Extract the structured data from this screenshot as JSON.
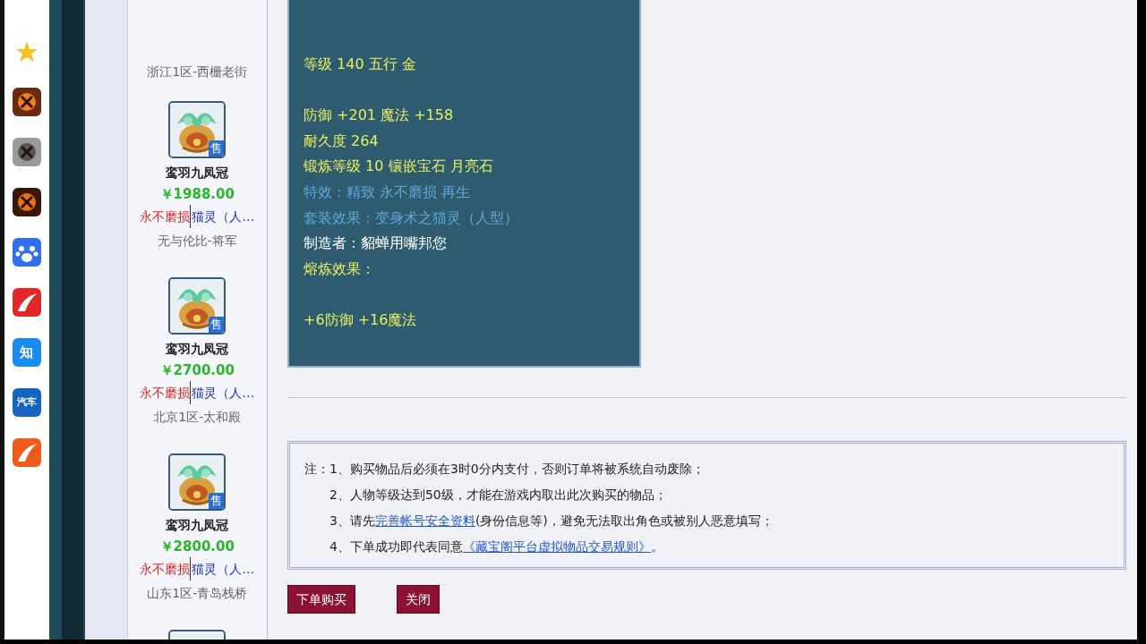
{
  "sidebar_apps": [
    {
      "kind": "star"
    },
    {
      "kind": "dragon"
    },
    {
      "kind": "long"
    },
    {
      "kind": "blast"
    },
    {
      "kind": "paw"
    },
    {
      "kind": "swoosh"
    },
    {
      "kind": "zhi",
      "label": "知"
    },
    {
      "kind": "car",
      "label": "汽车"
    },
    {
      "kind": "wing"
    }
  ],
  "items": [
    {
      "kind": "top_fragment",
      "location": "浙江1区-西栅老街"
    },
    {
      "badge": "售",
      "name": "鸾羽九凤冠",
      "price": "￥1988.00",
      "tags": [
        {
          "kind": "effect",
          "text": "永不磨损"
        },
        {
          "kind": "suit",
          "text": "猫灵（人…"
        }
      ],
      "location": "无与伦比-将军"
    },
    {
      "badge": "售",
      "name": "鸾羽九凤冠",
      "price": "￥2700.00",
      "tags": [
        {
          "kind": "effect",
          "text": "永不磨损"
        },
        {
          "kind": "suit",
          "text": "猫灵（人…"
        }
      ],
      "location": "北京1区-太和殿"
    },
    {
      "badge": "售",
      "name": "鸾羽九凤冠",
      "price": "￥2800.00",
      "tags": [
        {
          "kind": "effect",
          "text": "永不磨损"
        },
        {
          "kind": "suit",
          "text": "猫灵（人…"
        }
      ],
      "location": "山东1区-青岛栈桥"
    },
    {
      "kind": "bottom_fragment"
    }
  ],
  "tooltip_lines": [
    {
      "kind": "stat",
      "text": "等级 140 五行 金"
    },
    {
      "kind": "blank"
    },
    {
      "kind": "stat",
      "text": "防御 +201 魔法 +158"
    },
    {
      "kind": "stat",
      "text": "耐久度 264"
    },
    {
      "kind": "stat",
      "text": "锻炼等级 10 镶嵌宝石 月亮石"
    },
    {
      "kind": "special",
      "text": "特效：精致 永不磨损 再生"
    },
    {
      "kind": "special",
      "text": "套装效果：变身术之猫灵（人型）"
    },
    {
      "kind": "maker",
      "text": "制造者：貂蝉用嘴邦您"
    },
    {
      "kind": "stat",
      "text": "熔炼效果："
    },
    {
      "kind": "blank"
    },
    {
      "kind": "stat",
      "text": "+6防御 +16魔法"
    }
  ],
  "notes": {
    "label": "注：",
    "items": [
      {
        "number": "1、",
        "parts": [
          {
            "text": "购买物品后必须在3时0分内支付，否则订单将被系统自动废除；"
          }
        ]
      },
      {
        "number": "2、",
        "parts": [
          {
            "text": "人物等级达到50级，才能在游戏内取出此次购买的物品；"
          }
        ]
      },
      {
        "number": "3、",
        "parts": [
          {
            "text": "请先"
          },
          {
            "text": "完善帐号安全资料",
            "link": true
          },
          {
            "text": "(身份信息等)，避免无法取出角色或被别人恶意填写；"
          }
        ]
      },
      {
        "number": "4、",
        "parts": [
          {
            "text": "下单成功即代表同意"
          },
          {
            "text": "《藏宝阁平台虚拟物品交易规则》",
            "link": true
          },
          {
            "text": "。"
          }
        ]
      }
    ]
  },
  "buttons": [
    "下单购买",
    "关闭"
  ]
}
